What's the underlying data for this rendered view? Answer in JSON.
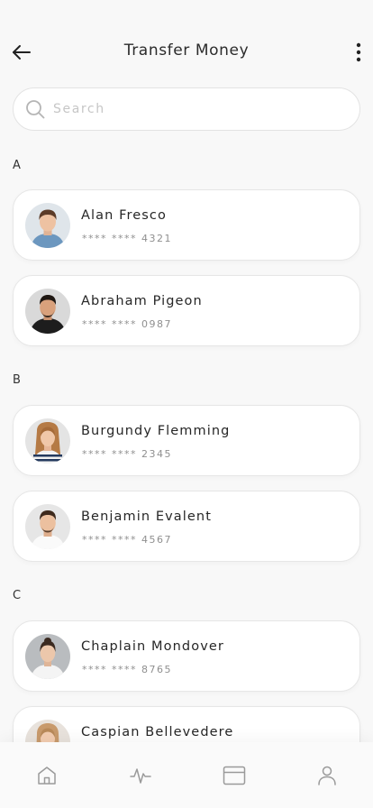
{
  "header": {
    "title": "Transfer Money",
    "back_icon": "arrow-left-icon",
    "more_icon": "more-vertical-icon"
  },
  "search": {
    "placeholder": "Search",
    "value": "",
    "icon": "search-icon"
  },
  "sections": [
    {
      "letter": "A",
      "contacts": [
        {
          "name": "Alan Fresco",
          "card": "**** **** 4321",
          "avatar": "man-denim-shirt"
        },
        {
          "name": "Abraham Pigeon",
          "card": "**** **** 0987",
          "avatar": "man-black-tshirt"
        }
      ]
    },
    {
      "letter": "B",
      "contacts": [
        {
          "name": "Burgundy Flemming",
          "card": "**** **** 2345",
          "avatar": "woman-striped-top"
        },
        {
          "name": "Benjamin Evalent",
          "card": "**** **** 4567",
          "avatar": "man-white-tshirt"
        }
      ]
    },
    {
      "letter": "C",
      "contacts": [
        {
          "name": "Chaplain Mondover",
          "card": "**** **** 8765",
          "avatar": "woman-white-top"
        },
        {
          "name": "Caspian Bellevedere",
          "card": "",
          "avatar": "woman-light-hair"
        }
      ]
    }
  ],
  "bottom_nav": [
    {
      "icon": "home-icon"
    },
    {
      "icon": "activity-icon"
    },
    {
      "icon": "card-icon"
    },
    {
      "icon": "profile-icon"
    }
  ],
  "colors": {
    "background": "#f8f8f8",
    "card": "#ffffff",
    "text": "#262626",
    "muted": "#8f8f8f",
    "icon": "#9a9a9a"
  }
}
